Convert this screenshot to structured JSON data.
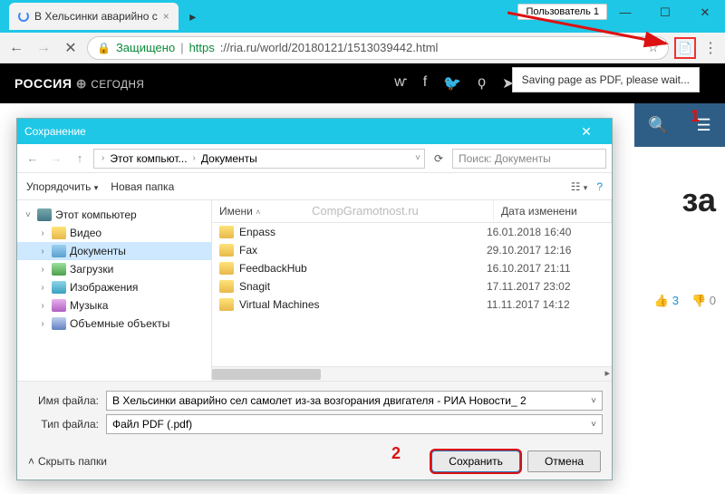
{
  "window": {
    "profile_label": "Пользователь 1",
    "tab_title": "В Хельсинки аварийно с",
    "secure_label": "Защищено",
    "url_proto": "https",
    "url_rest": "://ria.ru/world/20180121/1513039442.html",
    "tooltip": "Saving page as PDF, please wait..."
  },
  "ria": {
    "logo_a": "РОССИЯ",
    "logo_b": "СЕГОДНЯ"
  },
  "page": {
    "headline_fragment": "за",
    "thumbs_up": "3",
    "thumbs_down": "0"
  },
  "callouts": {
    "one": "1",
    "two": "2"
  },
  "dialog": {
    "title": "Сохранение",
    "crumb_root_icon": "pc",
    "crumb_root": "Этот компьют...",
    "crumb_leaf": "Документы",
    "search_placeholder": "Поиск: Документы",
    "organize": "Упорядочить",
    "newfolder": "Новая папка",
    "col_name": "Имени",
    "col_date": "Дата изменени",
    "watermark": "CompGramotnost.ru",
    "tree": [
      {
        "label": "Этот компьютер",
        "icon": "ic-pc",
        "tw": "˅",
        "indent": 0,
        "sel": false
      },
      {
        "label": "Видео",
        "icon": "ic-fold",
        "tw": "›",
        "indent": 1,
        "sel": false
      },
      {
        "label": "Документы",
        "icon": "ic-doc",
        "tw": "›",
        "indent": 1,
        "sel": true
      },
      {
        "label": "Загрузки",
        "icon": "ic-dl",
        "tw": "›",
        "indent": 1,
        "sel": false
      },
      {
        "label": "Изображения",
        "icon": "ic-img",
        "tw": "›",
        "indent": 1,
        "sel": false
      },
      {
        "label": "Музыка",
        "icon": "ic-mus",
        "tw": "›",
        "indent": 1,
        "sel": false
      },
      {
        "label": "Объемные объекты",
        "icon": "ic-3d",
        "tw": "›",
        "indent": 1,
        "sel": false
      }
    ],
    "rows": [
      {
        "name": "Enpass",
        "date": "16.01.2018 16:40"
      },
      {
        "name": "Fax",
        "date": "29.10.2017 12:16"
      },
      {
        "name": "FeedbackHub",
        "date": "16.10.2017 21:11"
      },
      {
        "name": "Snagit",
        "date": "17.11.2017 23:02"
      },
      {
        "name": "Virtual Machines",
        "date": "11.11.2017 14:12"
      }
    ],
    "filename_label": "Имя файла:",
    "filename_value": "В Хельсинки аварийно сел самолет из-за возгорания двигателя - РИА Новости_ 2",
    "filetype_label": "Тип файла:",
    "filetype_value": "Файл PDF (.pdf)",
    "hide_folders": "Скрыть папки",
    "save": "Сохранить",
    "cancel": "Отмена"
  }
}
